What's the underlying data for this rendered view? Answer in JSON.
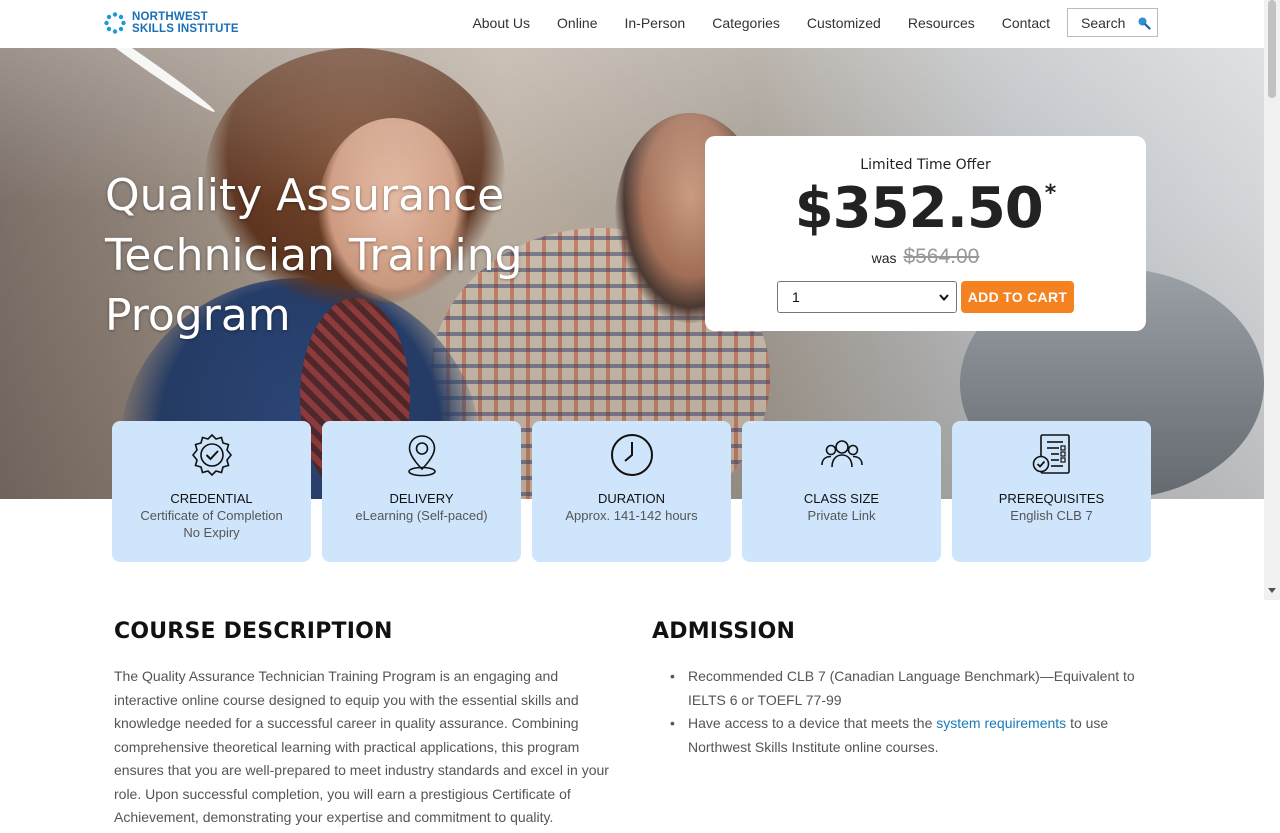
{
  "header": {
    "logo_line1": "NORTHWEST",
    "logo_line2": "SKILLS INSTITUTE",
    "nav": [
      "About Us",
      "Online",
      "In-Person",
      "Categories",
      "Customized",
      "Resources",
      "Contact"
    ],
    "search_label": "Search",
    "icons": {
      "logo": "dots-ring-logo",
      "search": "search-icon"
    }
  },
  "hero": {
    "title": "Quality Assurance Technician Training Program"
  },
  "offer": {
    "label": "Limited Time Offer",
    "price": "$352.50",
    "asterisk": "*",
    "was_label": "was",
    "old_price": "$564.00",
    "quantity": "1",
    "add_to_cart": "ADD TO CART"
  },
  "cards": [
    {
      "title": "CREDENTIAL",
      "value_line1": "Certificate of Completion",
      "value_line2": "No Expiry",
      "icon": "badge-check-icon"
    },
    {
      "title": "DELIVERY",
      "value_line1": "eLearning (Self-paced)",
      "value_line2": "",
      "icon": "location-pin-icon"
    },
    {
      "title": "DURATION",
      "value_line1": "Approx. 141-142 hours",
      "value_line2": "",
      "icon": "clock-icon"
    },
    {
      "title": "CLASS SIZE",
      "value_line1": "Private Link",
      "value_line2": "",
      "icon": "group-icon"
    },
    {
      "title": "PREREQUISITES",
      "value_line1": "English CLB 7",
      "value_line2": "",
      "icon": "checklist-icon"
    }
  ],
  "course_description": {
    "heading": "COURSE DESCRIPTION",
    "body": "The Quality Assurance Technician Training Program is an engaging and interactive online course designed to equip you with the essential skills and knowledge needed for a successful career in quality assurance. Combining comprehensive theoretical learning with practical applications, this program ensures that you are well-prepared to meet industry standards and excel in your role. Upon successful completion, you will earn a prestigious Certificate of Achievement, demonstrating your expertise and commitment to quality."
  },
  "admission": {
    "heading": "ADMISSION",
    "item1": "Recommended CLB 7 (Canadian Language Benchmark)—Equivalent to IELTS 6 or TOEFL 77-99",
    "item2_before": "Have access to a device that meets the ",
    "item2_link": "system requirements",
    "item2_after": " to use Northwest Skills Institute online courses."
  },
  "colors": {
    "brand_blue": "#1a6fb5",
    "accent_orange": "#f58220",
    "card_bg": "#cfe5fb",
    "link": "#1a7ab8"
  }
}
